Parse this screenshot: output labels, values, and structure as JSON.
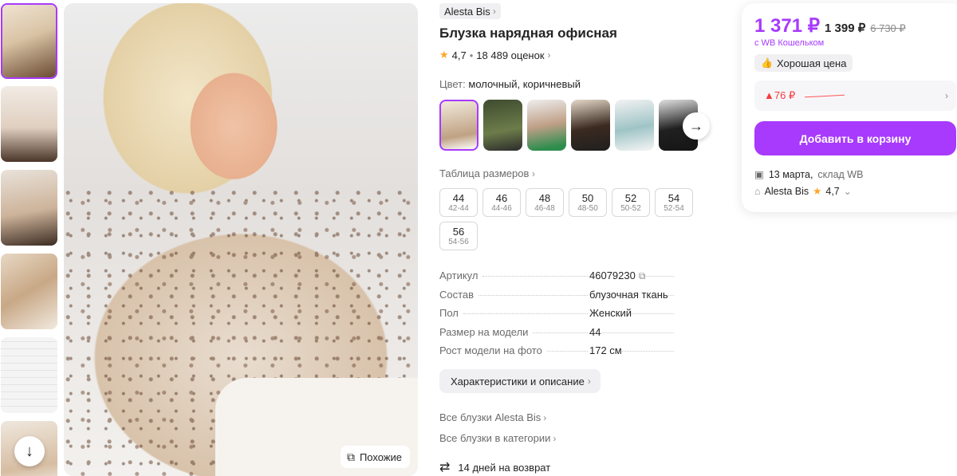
{
  "gallery": {
    "thumbnails": [
      {
        "alt": "blouse-front"
      },
      {
        "alt": "blouse-size-info"
      },
      {
        "alt": "blouse-full-body"
      },
      {
        "alt": "blouse-closeup"
      },
      {
        "alt": "size-chart"
      },
      {
        "alt": "blouse-side"
      }
    ],
    "scroll_icon": "↓",
    "similar_label": "Похожие",
    "similar_icon": "⧉"
  },
  "product": {
    "brand": "Alesta Bis",
    "title": "Блузка нарядная офисная",
    "rating": "4,7",
    "reviews": "18 489 оценок",
    "color_label": "Цвет:",
    "color_value": "молочный, коричневый",
    "size_table_link": "Таблица размеров",
    "sizes": [
      {
        "size": "44",
        "range": "42-44"
      },
      {
        "size": "46",
        "range": "44-46"
      },
      {
        "size": "48",
        "range": "46-48"
      },
      {
        "size": "50",
        "range": "48-50"
      },
      {
        "size": "52",
        "range": "50-52"
      },
      {
        "size": "54",
        "range": "52-54"
      },
      {
        "size": "56",
        "range": "54-56"
      }
    ],
    "specs": [
      {
        "key": "Артикул",
        "value": "46079230"
      },
      {
        "key": "Состав",
        "value": "блузочная ткань"
      },
      {
        "key": "Пол",
        "value": "Женский"
      },
      {
        "key": "Размер на модели",
        "value": "44"
      },
      {
        "key": "Рост модели на фото",
        "value": "172 см"
      }
    ],
    "description_button": "Характеристики и описание",
    "brand_link": "Все блузки Alesta Bis",
    "category_link": "Все блузки в категории",
    "returns": "14 дней на возврат"
  },
  "price_card": {
    "price": "1 371 ₽",
    "price_regular": "1 399 ₽",
    "price_old": "6 730 ₽",
    "wallet_note": "с WB Кошельком",
    "good_price": "Хорошая цена",
    "price_change": "▲76 ₽",
    "add_to_cart": "Добавить в корзину",
    "delivery_date": "13 марта,",
    "delivery_place": "склад WB",
    "seller_name": "Alesta Bis",
    "seller_rating": "4,7"
  },
  "colors": {
    "accent": "#a73afd",
    "star": "#ffa629",
    "price_up": "#f53c3c"
  }
}
